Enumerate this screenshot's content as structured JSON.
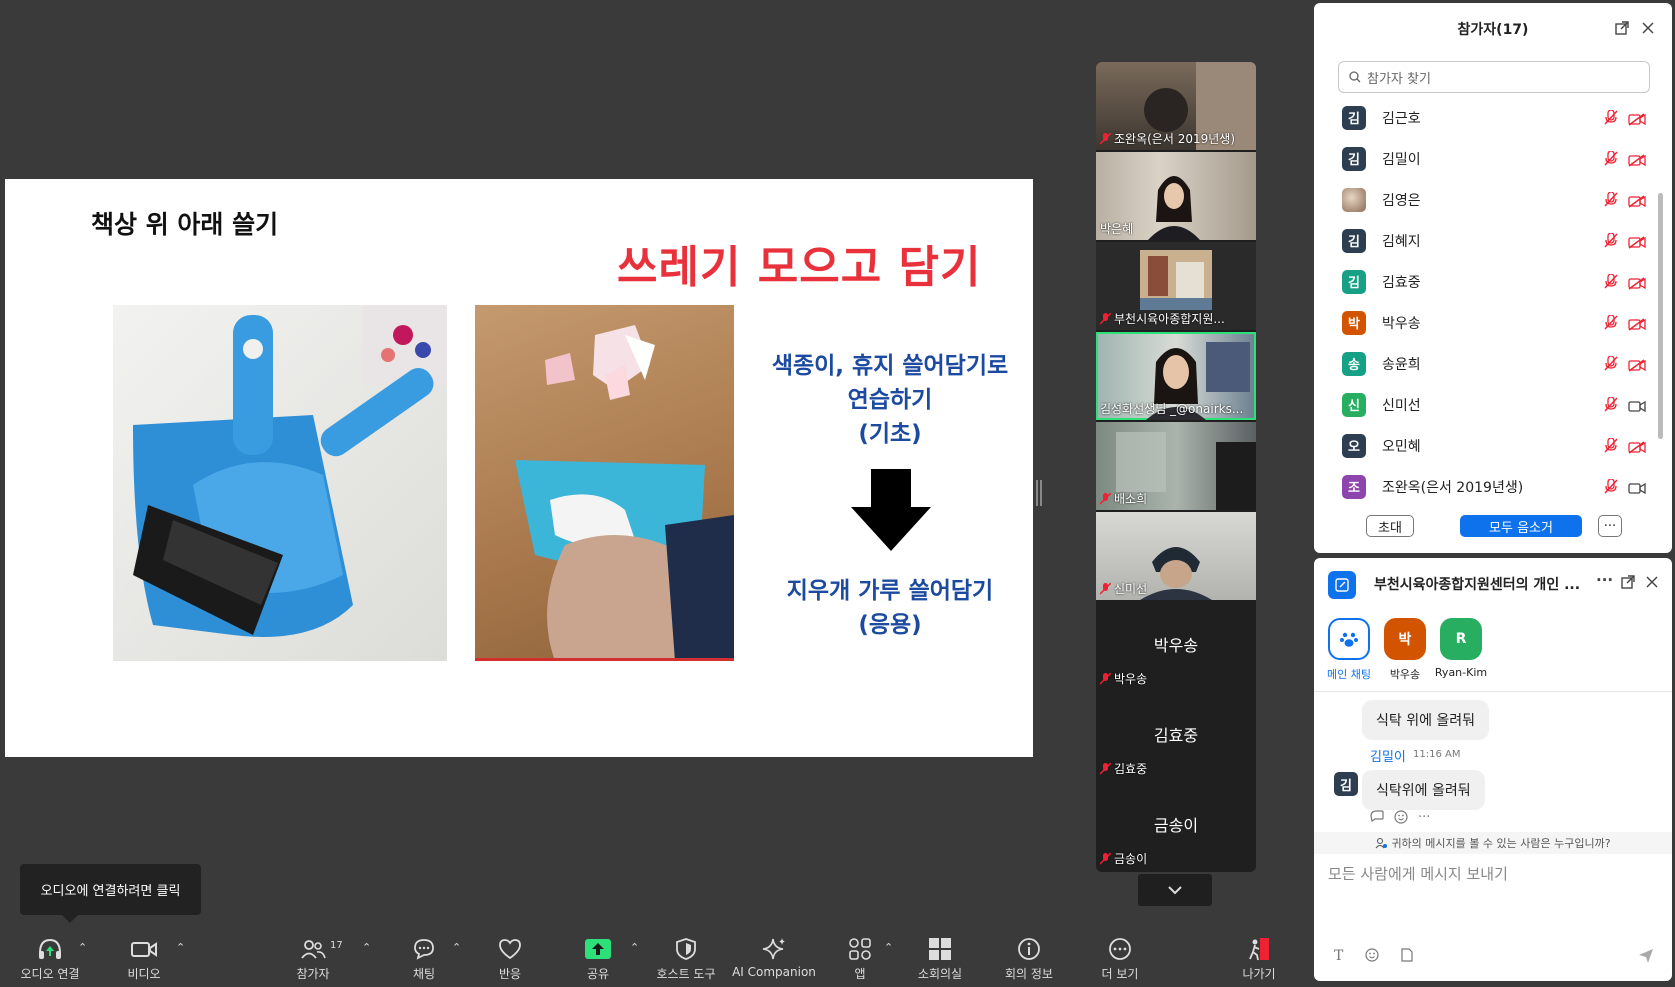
{
  "slide": {
    "title": "책상 위 아래 쓸기",
    "headline": "쓰레기 모으고 담기",
    "text_basic_line1": "색종이, 휴지 쓸어담기로",
    "text_basic_line2": "연습하기",
    "text_basic_line3": "(기초)",
    "text_applied_line1": "지우개 가루 쓸어담기",
    "text_applied_line2": "(응용)"
  },
  "video_tiles": [
    {
      "name": "조완옥(은서 2019년생)",
      "muted": true
    },
    {
      "name": "박은혜",
      "muted": false
    },
    {
      "name": "부천시육아종합지원...",
      "muted": true
    },
    {
      "name": "김성화선생님 _@onairks...",
      "muted": false,
      "active": true
    },
    {
      "name": "배소희",
      "muted": true
    },
    {
      "name": "신미선",
      "muted": true
    },
    {
      "name": "박우송",
      "center": "박우송",
      "muted": true
    },
    {
      "name": "김효중",
      "center": "김효중",
      "muted": true
    },
    {
      "name": "금송이",
      "center": "금송이",
      "muted": true
    }
  ],
  "participants": {
    "title": "참가자(17)",
    "search_placeholder": "참가자 찾기",
    "list": [
      {
        "initial": "김",
        "name": "김근호",
        "color": "#2c3e50",
        "cam": "off"
      },
      {
        "initial": "김",
        "name": "김밀이",
        "color": "#2c3e50",
        "cam": "off"
      },
      {
        "initial": "",
        "name": "김영은",
        "color": "#8a6b55",
        "cam": "off",
        "photo": true
      },
      {
        "initial": "김",
        "name": "김혜지",
        "color": "#2c3e50",
        "cam": "off"
      },
      {
        "initial": "김",
        "name": "김효중",
        "color": "#16a085",
        "cam": "off"
      },
      {
        "initial": "박",
        "name": "박우송",
        "color": "#d35400",
        "cam": "off"
      },
      {
        "initial": "송",
        "name": "송윤희",
        "color": "#16a085",
        "cam": "off"
      },
      {
        "initial": "신",
        "name": "신미선",
        "color": "#27ae60",
        "cam": "on"
      },
      {
        "initial": "오",
        "name": "오민혜",
        "color": "#2c3e50",
        "cam": "off"
      },
      {
        "initial": "조",
        "name": "조완옥(은서 2019년생)",
        "color": "#8e44ad",
        "cam": "on"
      }
    ],
    "invite_label": "초대",
    "mute_all_label": "모두 음소거",
    "more_label": "···"
  },
  "chat": {
    "title": "부천시육아종합지원센터의 개인 ...",
    "recipients": [
      {
        "label": "메인 채팅",
        "initial": "",
        "color": "#ffffff"
      },
      {
        "label": "박우송",
        "initial": "박",
        "color": "#d35400"
      },
      {
        "label": "Ryan-Kim",
        "initial": "R",
        "color": "#27ae60"
      }
    ],
    "message_prev": "식탁 위에 올려둬",
    "sender_name": "김밀이",
    "sender_time": "11:16 AM",
    "sender_initial": "김",
    "message_last": "식탁위에 올려둬",
    "visibility_note": "귀하의 메시지를 볼 수 있는 사람은 누구입니까?",
    "input_placeholder": "모든 사람에게 메시지 보내기"
  },
  "toolbar": {
    "audio": "오디오 연결",
    "video": "비디오",
    "participants": "참가자",
    "participants_count": "17",
    "chat": "채팅",
    "reactions": "반응",
    "share": "공유",
    "host_tools": "호스트 도구",
    "ai": "AI Companion",
    "apps": "앱",
    "breakout": "소회의실",
    "info": "회의 정보",
    "more": "더 보기",
    "leave": "나가기"
  },
  "tooltip": {
    "audio": "오디오에 연결하려면 클릭"
  },
  "colors": {
    "accent": "#0e72ed",
    "active_border": "#2ee07a",
    "headline": "#e8313b",
    "slide_text": "#1b4aa0"
  }
}
